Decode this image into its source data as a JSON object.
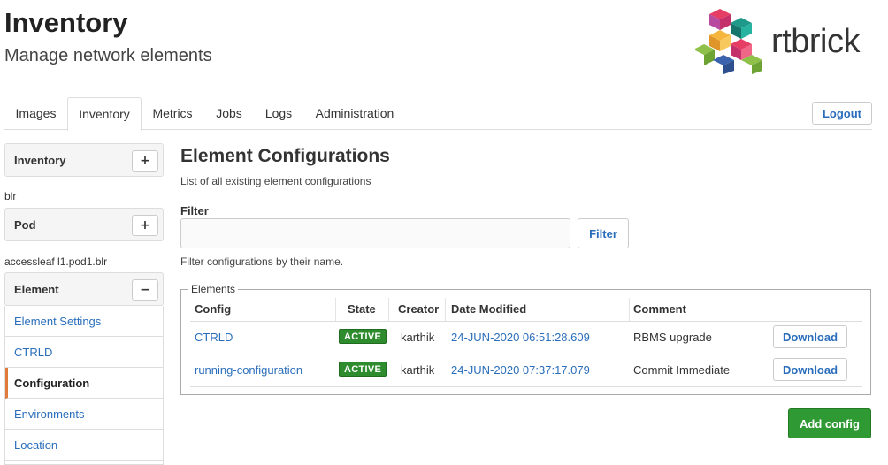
{
  "header": {
    "title": "Inventory",
    "subtitle": "Manage network elements",
    "brand_name": "rtbrick",
    "brand_colors": [
      "#e63d64",
      "#8fc04a",
      "#f6b63d",
      "#1f9a8a",
      "#b84aa0",
      "#3b63ad"
    ]
  },
  "nav": {
    "tabs": [
      {
        "label": "Images"
      },
      {
        "label": "Inventory"
      },
      {
        "label": "Metrics"
      },
      {
        "label": "Jobs"
      },
      {
        "label": "Logs"
      },
      {
        "label": "Administration"
      }
    ],
    "active_tab": "Inventory",
    "logout_label": "Logout"
  },
  "sidebar": {
    "inventory_panel": {
      "title": "Inventory",
      "toggle": "+"
    },
    "pod_context": "blr",
    "pod_panel": {
      "title": "Pod",
      "toggle": "+"
    },
    "element_context": "accessleaf l1.pod1.blr",
    "element_panel": {
      "title": "Element",
      "toggle": "−"
    },
    "items": [
      {
        "label": "Element Settings"
      },
      {
        "label": "CTRLD"
      },
      {
        "label": "Configuration"
      },
      {
        "label": "Environments"
      },
      {
        "label": "Location"
      }
    ],
    "active_item": "Configuration"
  },
  "main": {
    "title": "Element Configurations",
    "description": "List of all existing element configurations",
    "filter": {
      "label": "Filter",
      "value": "",
      "placeholder": "",
      "button_label": "Filter",
      "help": "Filter configurations by their name."
    },
    "elements": {
      "legend": "Elements",
      "columns": [
        "Config",
        "State",
        "Creator",
        "Date Modified",
        "Comment"
      ],
      "rows": [
        {
          "config": "CTRLD",
          "state": "ACTIVE",
          "creator": "karthik",
          "date_modified": "24-JUN-2020 06:51:28.609",
          "comment": "RBMS upgrade",
          "action": "Download"
        },
        {
          "config": "running-configuration",
          "state": "ACTIVE",
          "creator": "karthik",
          "date_modified": "24-JUN-2020 07:37:17.079",
          "comment": "Commit Immediate",
          "action": "Download"
        }
      ]
    },
    "add_button_label": "Add config"
  },
  "colors": {
    "link": "#2a6ebb",
    "active_badge": "#2e8b2e",
    "primary_button": "#2f9a33",
    "active_indicator": "#e07b39"
  }
}
